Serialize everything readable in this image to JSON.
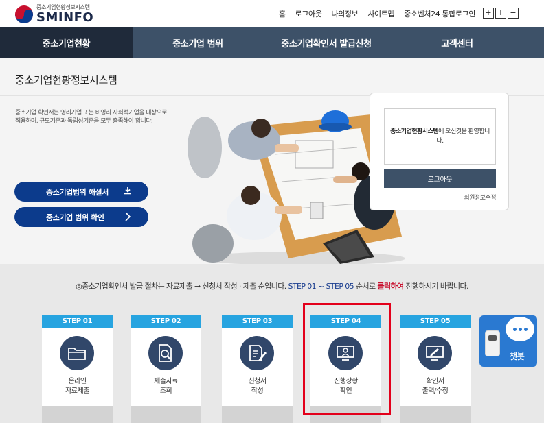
{
  "header": {
    "logo_sub": "중소기업현황정보시스템",
    "logo_main": "SMINFO",
    "util_links": [
      "홈",
      "로그아웃",
      "나의정보",
      "사이트맵",
      "중소벤처24 통합로그인"
    ],
    "font_buttons": [
      "+",
      "T",
      "−"
    ]
  },
  "nav": {
    "items": [
      {
        "label": "중소기업현황",
        "active": true
      },
      {
        "label": "중소기업 범위",
        "active": false
      },
      {
        "label": "중소기업확인서 발급신청",
        "active": false
      },
      {
        "label": "고객센터",
        "active": false
      }
    ]
  },
  "hero": {
    "title": "중소기업현황정보시스템",
    "description": "중소기업 확인서는 영리기업 또는 비영리 사회적기업을 대상으로 적용하며, 규모기준과 독립성기준을 모두 충족해야 합니다.",
    "button_guide": "중소기업범위 해설서",
    "button_check": "중소기업 범위 확인"
  },
  "login_box": {
    "welcome_bold": "중소기업현황시스템",
    "welcome_rest": "에 오신것을 환영합니다.",
    "logout_label": "로그아웃",
    "member_edit": "회원정보수정"
  },
  "guide": {
    "part1": "◎중소기업확인서 발급 절차는 자료제출 → 신청서 작성 · 제출 순입니다.",
    "part2": " STEP 01 ~ STEP 05",
    "part3": " 순서로 ",
    "part4": "클릭하여",
    "part5": " 진행하시기 바랍니다."
  },
  "steps": [
    {
      "head": "STEP 01",
      "line1": "온라인",
      "line2": "자료제출",
      "icon": "folder-icon"
    },
    {
      "head": "STEP 02",
      "line1": "제출자료",
      "line2": "조회",
      "icon": "document-search-icon"
    },
    {
      "head": "STEP 03",
      "line1": "신청서",
      "line2": "작성",
      "icon": "document-edit-icon"
    },
    {
      "head": "STEP 04",
      "line1": "진행상황",
      "line2": "확인",
      "icon": "monitor-person-icon"
    },
    {
      "head": "STEP 05",
      "line1": "확인서",
      "line2": "출력/수정",
      "icon": "monitor-edit-icon"
    }
  ],
  "chatbot": {
    "label": "챗봇"
  },
  "colors": {
    "nav_bg": "#3d5168",
    "nav_active": "#1f2a3a",
    "primary_blue": "#0c3b8c",
    "step_head": "#27a4e0",
    "step_circle": "#31476a",
    "highlight": "#e3001b"
  }
}
